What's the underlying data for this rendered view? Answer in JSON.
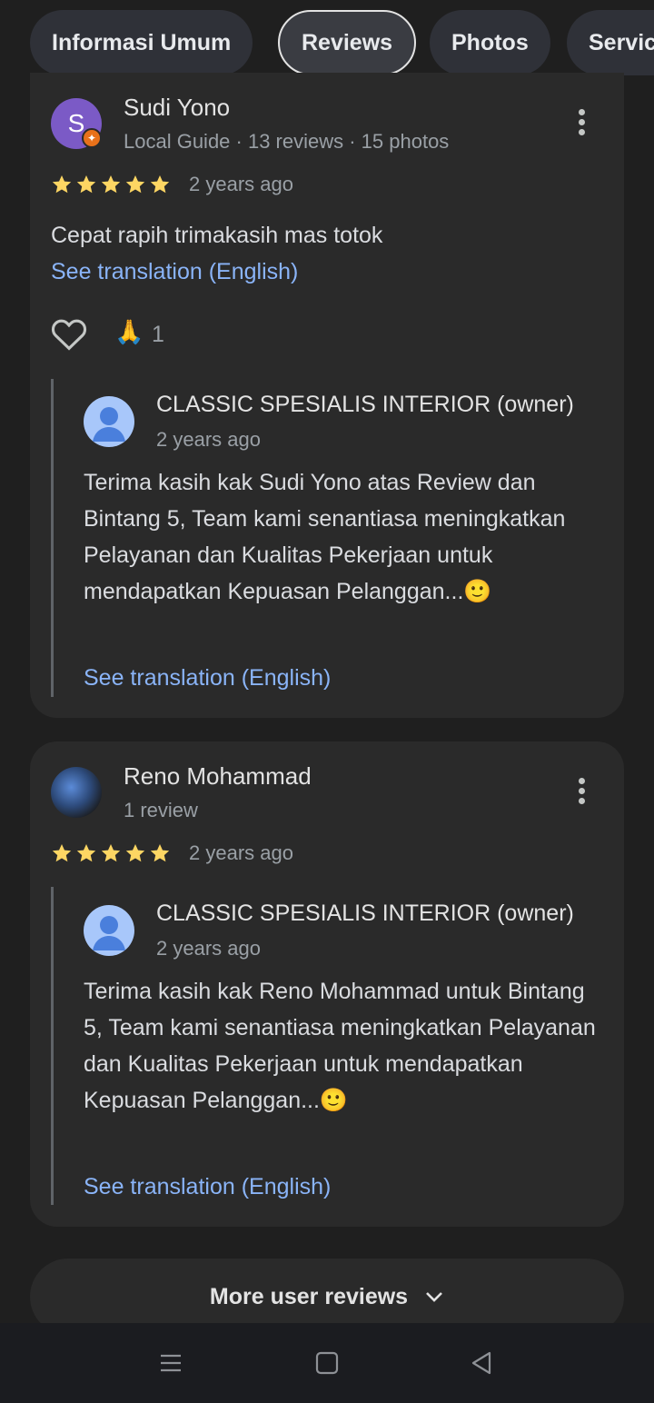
{
  "tabs": [
    "Informasi Umum",
    "Reviews",
    "Photos",
    "Services"
  ],
  "reviews": [
    {
      "avatar_letter": "S",
      "name": "Sudi Yono",
      "meta": "Local Guide · 13 reviews · 15 photos",
      "rating": 5,
      "time": "2 years ago",
      "text": "Cepat rapih trimakasih mas totok",
      "translate": "See translation (English)",
      "reaction_emoji": "🙏",
      "reaction_count": "1",
      "reply": {
        "owner": "CLASSIC SPESIALIS INTERIOR (owner)",
        "time": "2 years ago",
        "text": "Terima kasih kak Sudi Yono atas Review dan Bintang 5, Team kami senantiasa meningkatkan Pelayanan dan Kualitas Pekerjaan untuk mendapatkan Kepuasan Pelanggan...🙂",
        "translate": "See translation (English)"
      }
    },
    {
      "name": "Reno Mohammad",
      "meta": "1 review",
      "rating": 5,
      "time": "2 years ago",
      "reply": {
        "owner": "CLASSIC SPESIALIS INTERIOR (owner)",
        "time": "2 years ago",
        "text": "Terima kasih kak Reno Mohammad untuk Bintang 5, Team kami senantiasa meningkatkan Pelayanan dan Kualitas Pekerjaan untuk mendapatkan Kepuasan Pelanggan...🙂",
        "translate": "See translation (English)"
      }
    }
  ],
  "more_reviews_label": "More user reviews",
  "colors": {
    "link": "#8ab4f8",
    "star": "#fdd663",
    "card": "#2a2a2a",
    "background": "#1f1f1f"
  }
}
